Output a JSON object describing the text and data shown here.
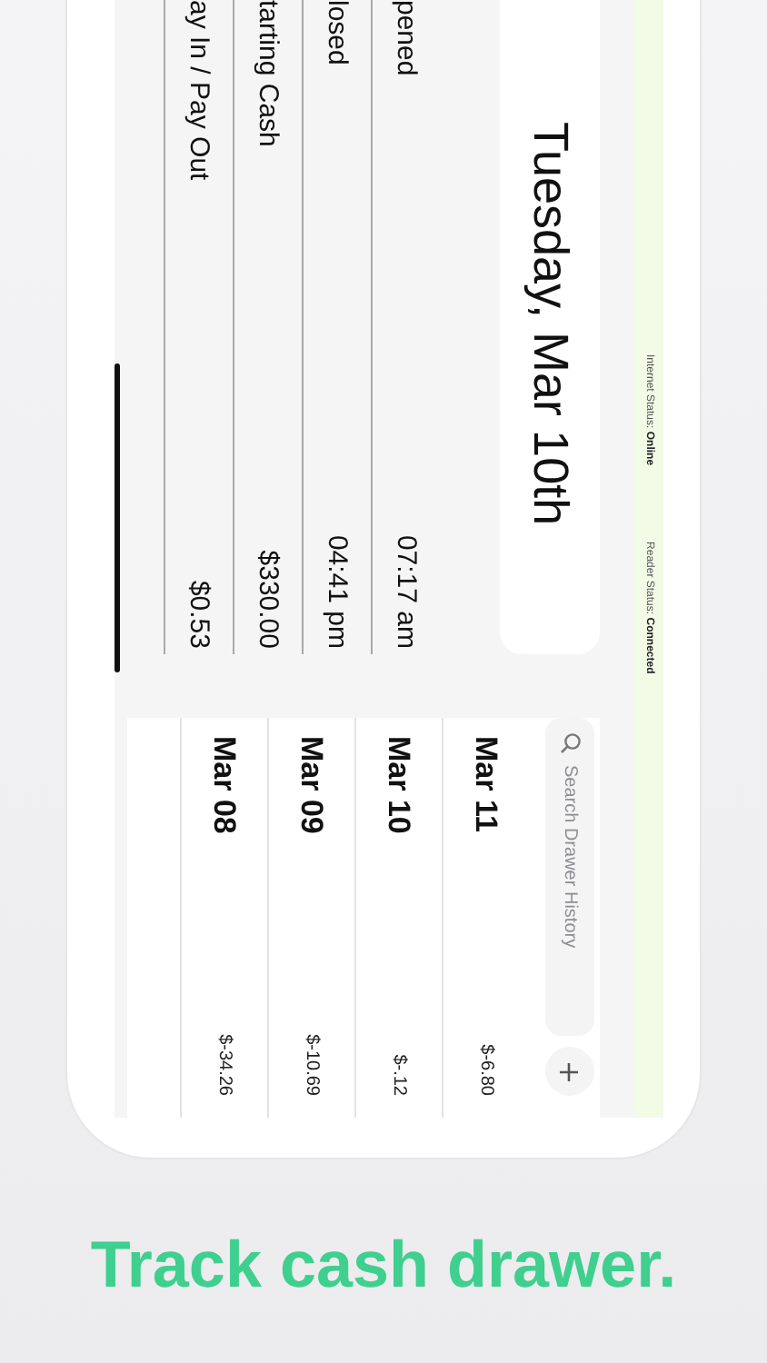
{
  "status_bar": [
    {
      "label": "Internet Status:",
      "value": "Online"
    },
    {
      "label": "Reader Status:",
      "value": "Connected"
    }
  ],
  "day_title": "Tuesday, Mar 10th",
  "search": {
    "placeholder": "Search Drawer History"
  },
  "summary_rows": [
    {
      "label": "pened",
      "value": "07:17 am"
    },
    {
      "label": "losed",
      "value": "04:41 pm"
    },
    {
      "label": "tarting Cash",
      "value": "$330.00"
    },
    {
      "label": "ay In / Pay Out",
      "value": "$0.53"
    }
  ],
  "history": [
    {
      "date": "Mar 11",
      "amount": "$-6.80"
    },
    {
      "date": "Mar 10",
      "amount": "$-.12"
    },
    {
      "date": "Mar 09",
      "amount": "$-10.69"
    },
    {
      "date": "Mar 08",
      "amount": "$-34.26"
    }
  ],
  "headline": "Track cash drawer."
}
